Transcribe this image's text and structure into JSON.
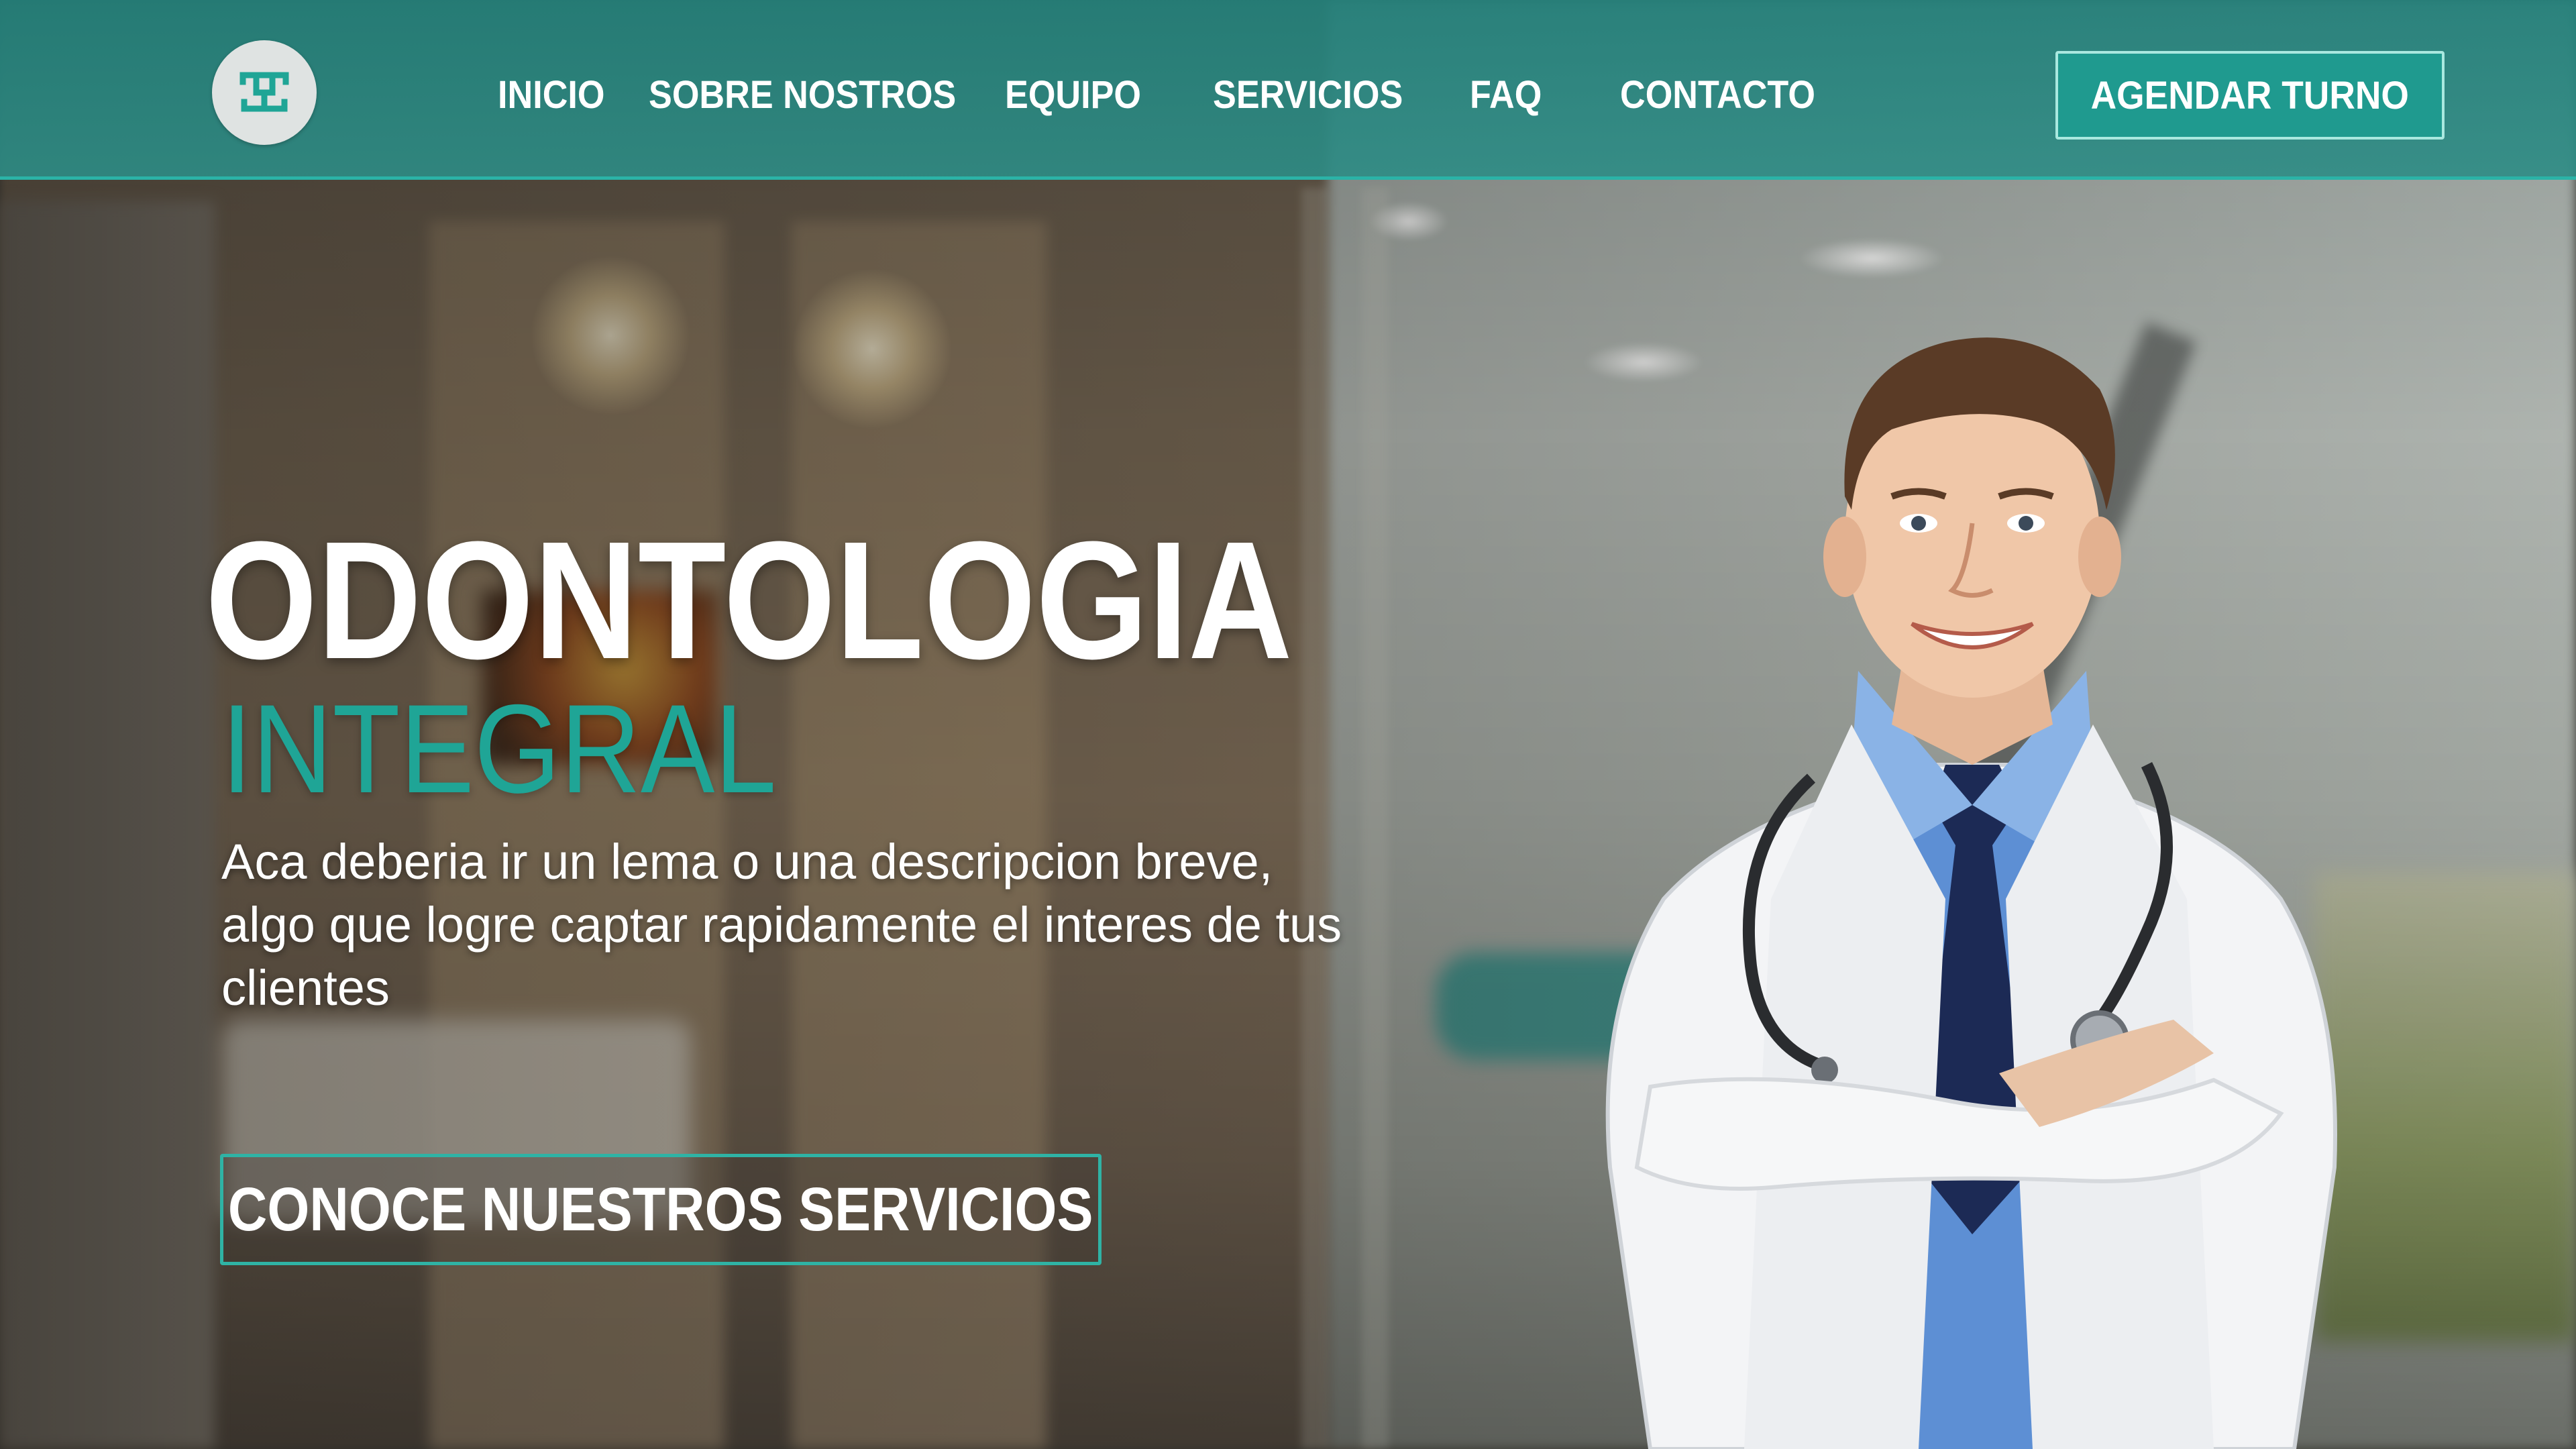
{
  "brand": {
    "logo_icon": "tooth-monogram-icon",
    "accent_color": "#1fa596",
    "header_color": "#2d8c85"
  },
  "nav": {
    "items": [
      {
        "label": "INICIO"
      },
      {
        "label": "SOBRE NOSTROS"
      },
      {
        "label": "EQUIPO"
      },
      {
        "label": "SERVICIOS"
      },
      {
        "label": "FAQ"
      },
      {
        "label": "CONTACTO"
      }
    ],
    "cta_label": "AGENDAR TURNO"
  },
  "hero": {
    "title": "ODONTOLOGIA",
    "subtitle": "INTEGRAL",
    "description": "Aca deberia ir un lema o una descripcion breve, algo que logre captar rapidamente el interes de tus clientes",
    "button_label": "CONOCE NUESTROS SERVICIOS",
    "image_subject": "doctor-portrait"
  }
}
